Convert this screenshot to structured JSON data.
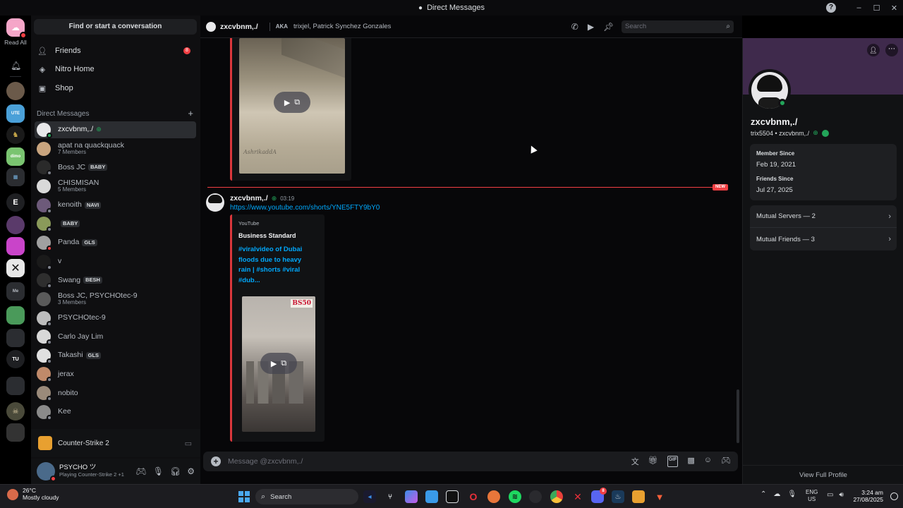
{
  "window": {
    "title": "Direct Messages",
    "help_icon": "?",
    "minimize": "–",
    "maximize": "☐",
    "close": "✕"
  },
  "rail": {
    "read_all": "Read All",
    "server_letters": [
      "E",
      "TU"
    ],
    "mini_label": "Me"
  },
  "sidebar": {
    "find_button": "Find or start a conversation",
    "nav": [
      {
        "label": "Friends",
        "badge": "8"
      },
      {
        "label": "Nitro Home"
      },
      {
        "label": "Shop"
      }
    ],
    "dm_header": "Direct Messages",
    "add_dm": "+",
    "dms": [
      {
        "name": "zxcvbnm,./",
        "sub": "",
        "tag": "",
        "status": "online",
        "color": "#e8e8ea"
      },
      {
        "name": "apat na quackquack",
        "sub": "7 Members",
        "tag": "",
        "status": "none",
        "color": "#c8a47e"
      },
      {
        "name": "Boss JC",
        "sub": "",
        "tag": "BABY",
        "status": "offline",
        "color": "#2a2a2a"
      },
      {
        "name": "CHISMISAN",
        "sub": "5 Members",
        "tag": "",
        "status": "none",
        "color": "#d9d9d9"
      },
      {
        "name": "kenoith",
        "sub": "",
        "tag": "NAVI",
        "status": "offline",
        "color": "#6d5a7a"
      },
      {
        "name": "",
        "sub": "",
        "tag": "BABY",
        "status": "offline",
        "color": "#8a9a5a"
      },
      {
        "name": "Panda",
        "sub": "",
        "tag": "GLS",
        "status": "dnd",
        "color": "#a0a0a0"
      },
      {
        "name": "v",
        "sub": "",
        "tag": "",
        "status": "offline",
        "color": "#1a1a1a"
      },
      {
        "name": "Swang",
        "sub": "",
        "tag": "BESH",
        "status": "offline",
        "color": "#2e2e2e"
      },
      {
        "name": "Boss JC, PSYCHOtec-9",
        "sub": "3 Members",
        "tag": "",
        "status": "none",
        "color": "#5a5a5a"
      },
      {
        "name": "PSYCHOtec-9",
        "sub": "",
        "tag": "",
        "status": "offline",
        "color": "#bdbdbd"
      },
      {
        "name": "Carlo Jay Lim",
        "sub": "",
        "tag": "",
        "status": "offline",
        "color": "#d8d8d8"
      },
      {
        "name": "Takashi",
        "sub": "",
        "tag": "GLS",
        "status": "offline",
        "color": "#e0e0e0"
      },
      {
        "name": "jerax",
        "sub": "",
        "tag": "",
        "status": "offline",
        "color": "#c08a6a"
      },
      {
        "name": "nobito",
        "sub": "",
        "tag": "",
        "status": "offline",
        "color": "#9a8a7a"
      },
      {
        "name": "Kee",
        "sub": "",
        "tag": "",
        "status": "offline",
        "color": "#8a8a8a"
      }
    ],
    "activity": "Counter-Strike 2",
    "user": {
      "name": "PSYCHO ツ",
      "status": "Playing Counter-Strike 2 +1"
    }
  },
  "chat_header": {
    "name": "zxcvbnm,./",
    "aka_label": "AKA",
    "aka_names": "trixjel, Patrick Synchez Gonzales",
    "search_placeholder": "Search"
  },
  "messages": {
    "video1_watermark": "AshrikaddA",
    "new_label": "NEW",
    "author": "zxcvbnm,./",
    "time": "03:19",
    "link": "https://www.youtube.com/shorts/YNE5FTY9bY0",
    "embed": {
      "provider": "YouTube",
      "author": "Business Standard",
      "title": "#viralvideo of Dubai floods due to heavy rain | #shorts #viral #dub...",
      "logo_text": "BS50"
    }
  },
  "composer": {
    "placeholder": "Message @zxcvbnm,./"
  },
  "profile": {
    "display_name": "zxcvbnm,./",
    "username_line": "trix5504 • zxcvbnm,./",
    "member_since_label": "Member Since",
    "member_since": "Feb 19, 2021",
    "friends_since_label": "Friends Since",
    "friends_since": "Jul 27, 2025",
    "mutual_servers": "Mutual Servers — 2",
    "mutual_friends": "Mutual Friends — 3",
    "view_full": "View Full Profile"
  },
  "taskbar": {
    "temp": "26°C",
    "weather": "Mostly cloudy",
    "search": "Search",
    "lang1": "ENG",
    "lang2": "US",
    "time": "3:24 am",
    "date": "27/08/2025",
    "discord_badge": "8"
  },
  "colors": {
    "accent": "#5865f2",
    "red": "#f23f43",
    "online": "#23a55a",
    "link": "#00a8fc",
    "banner": "#3f2a4c"
  }
}
